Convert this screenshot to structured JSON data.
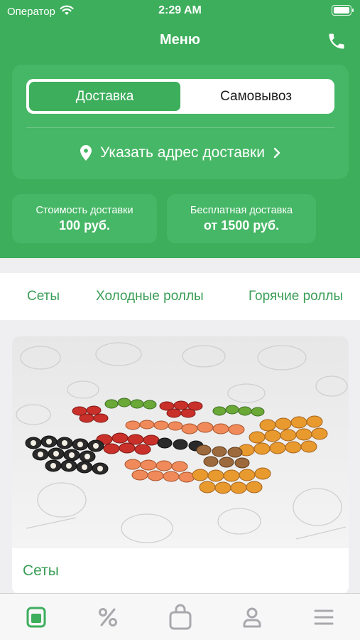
{
  "status_bar": {
    "carrier": "Оператор",
    "time": "2:29 AM"
  },
  "header": {
    "title": "Меню"
  },
  "delivery": {
    "tabs": [
      {
        "label": "Доставка",
        "active": true
      },
      {
        "label": "Самовывоз",
        "active": false
      }
    ],
    "address_label": "Указать адрес доставки"
  },
  "info": {
    "cost": {
      "label": "Стоимость доставки",
      "value": "100 руб."
    },
    "free": {
      "label": "Бесплатная доставка",
      "value": "от 1500 руб."
    }
  },
  "categories": [
    "Сеты",
    "Холодные роллы",
    "Горячие роллы"
  ],
  "product": {
    "title": "Сеты",
    "image_description": "sushi-rolls-photo"
  },
  "tabbar": {
    "items": [
      {
        "icon": "menu-icon",
        "active": true
      },
      {
        "icon": "percent-icon",
        "active": false
      },
      {
        "icon": "bag-icon",
        "active": false
      },
      {
        "icon": "profile-icon",
        "active": false
      },
      {
        "icon": "hamburger-icon",
        "active": false
      }
    ]
  },
  "colors": {
    "brand_green": "#3dae5c",
    "card_green": "#46b766",
    "category_text": "#3a9e56",
    "inactive_icon": "#a8a8ad"
  }
}
